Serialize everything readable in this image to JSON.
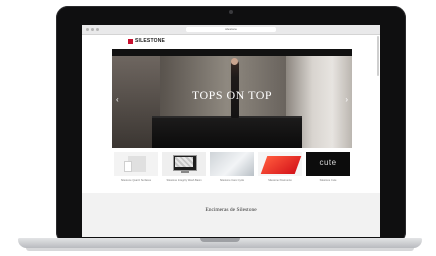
{
  "browser": {
    "url": "silestone"
  },
  "site": {
    "brand": "SILESTONE",
    "brand_color": "#c8102e",
    "top_links": [
      "",
      "",
      "",
      "",
      "",
      "",
      ""
    ]
  },
  "nav": {
    "items": [
      "",
      "",
      "",
      "",
      "",
      "",
      "",
      "",
      "",
      ""
    ]
  },
  "hero": {
    "title": "TOPS ON TOP",
    "subtitle": ""
  },
  "thumbnails": [
    {
      "label": "Silestone Quartz Surfaces"
    },
    {
      "label": "Silestone Integrity Wash Basin"
    },
    {
      "label": "Silestone Care Cycle"
    },
    {
      "label": "Silestone Pavimento"
    },
    {
      "label": "Silestone Cute"
    }
  ],
  "thumbnail5_text": "cute",
  "bottom": {
    "title": "Encimeras de Silestone",
    "text": ""
  }
}
